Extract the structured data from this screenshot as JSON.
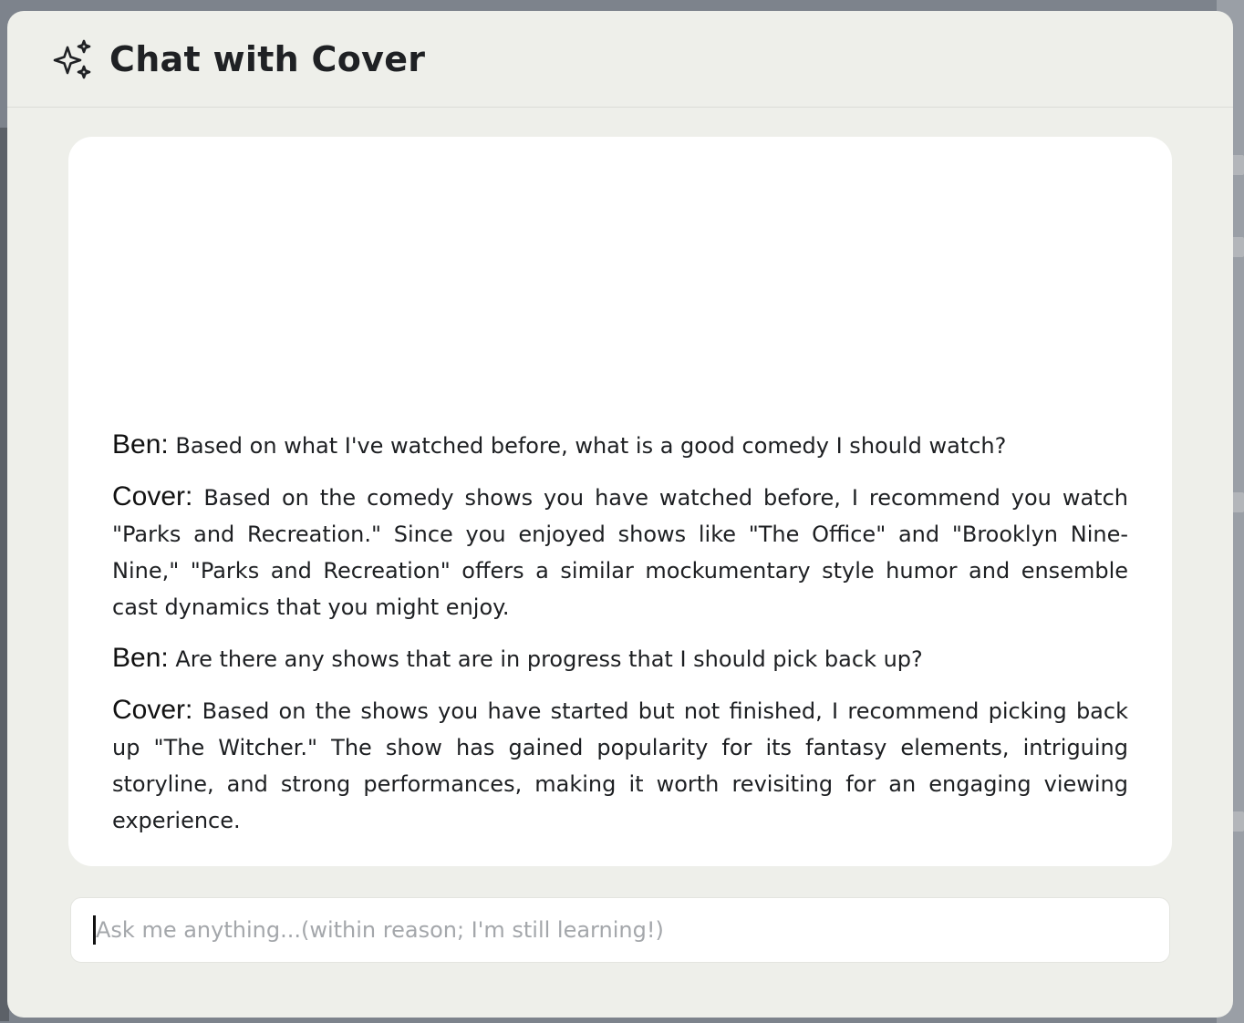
{
  "modal": {
    "title": "Chat with Cover",
    "icon": "sparkle-icon"
  },
  "chat": {
    "messages": [
      {
        "speaker": "Ben:",
        "text": "Based on what I've watched before, what is a good comedy I should watch?"
      },
      {
        "speaker": "Cover:",
        "text": "Based on the comedy shows you have watched before, I recommend you watch \"Parks and Recreation.\" Since you enjoyed shows like \"The Office\" and \"Brooklyn Nine-Nine,\" \"Parks and Recreation\" offers a similar mockumentary style humor and ensemble cast dynamics that you might enjoy."
      },
      {
        "speaker": "Ben:",
        "text": "Are there any shows that are in progress that I should pick back up?"
      },
      {
        "speaker": "Cover:",
        "text": "Based on the shows you have started but not finished, I recommend picking back up \"The Witcher.\" The show has gained popularity for its fantasy elements, intriguing storyline, and strong performances, making it worth revisiting for an engaging viewing experience."
      }
    ]
  },
  "input": {
    "placeholder": "Ask me anything...(within reason; I'm still learning!)",
    "value": ""
  },
  "colors": {
    "modal_bg": "#eeefea",
    "panel_bg": "#ffffff",
    "overlay": "#7d838c"
  }
}
